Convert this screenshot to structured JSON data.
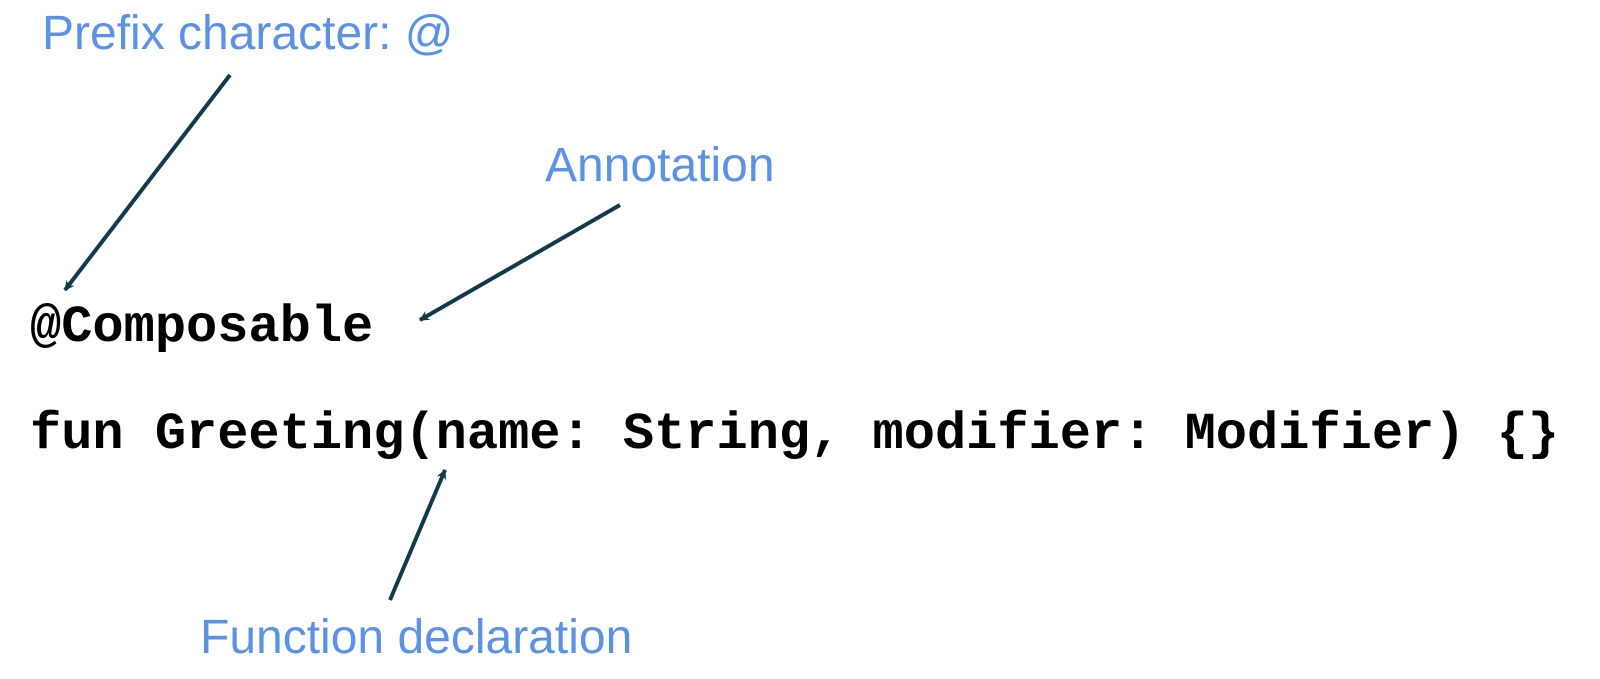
{
  "labels": {
    "prefix": "Prefix character: @",
    "annotation": "Annotation",
    "function_declaration": "Function declaration"
  },
  "code": {
    "line1": "@Composable",
    "line2": "fun Greeting(name: String, modifier: Modifier) {}"
  },
  "colors": {
    "label": "#5c92e6",
    "arrow": "#123a4a",
    "code": "#000000"
  }
}
